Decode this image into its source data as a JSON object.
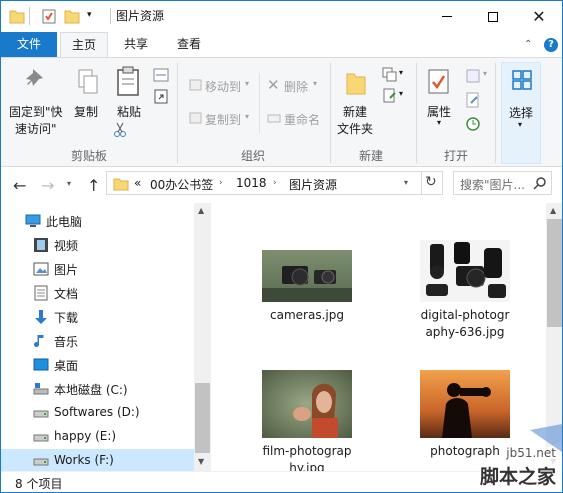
{
  "window": {
    "title": "图片资源"
  },
  "ribbon_tabs": [
    "文件",
    "主页",
    "共享",
    "查看"
  ],
  "clipboard": {
    "pin_label_1": "固定到\"快",
    "pin_label_2": "速访问\"",
    "copy_label": "复制",
    "paste_label": "粘贴",
    "group_label": "剪贴板"
  },
  "organize": {
    "move_label": "移动到",
    "copyto_label": "复制到",
    "delete_label": "删除",
    "rename_label": "重命名",
    "group_label": "组织"
  },
  "new": {
    "folder_label_1": "新建",
    "folder_label_2": "文件夹",
    "group_label": "新建"
  },
  "open": {
    "props_label": "属性",
    "group_label": "打开"
  },
  "select": {
    "label": "选择"
  },
  "address": {
    "overflow": "«",
    "crumbs": [
      "00办公书签",
      "1018",
      "图片资源"
    ],
    "search_placeholder": "搜索\"图片..."
  },
  "nav": {
    "items": [
      {
        "label": "此电脑",
        "icon": "computer-icon"
      },
      {
        "label": "视频",
        "icon": "video-icon"
      },
      {
        "label": "图片",
        "icon": "pictures-icon"
      },
      {
        "label": "文档",
        "icon": "documents-icon"
      },
      {
        "label": "下载",
        "icon": "download-icon"
      },
      {
        "label": "音乐",
        "icon": "music-icon"
      },
      {
        "label": "桌面",
        "icon": "desktop-icon"
      },
      {
        "label": "本地磁盘 (C:)",
        "icon": "drive-c-icon"
      },
      {
        "label": "Softwares (D:)",
        "icon": "drive-icon"
      },
      {
        "label": "happy (E:)",
        "icon": "drive-icon"
      },
      {
        "label": "Works (F:)",
        "icon": "drive-icon"
      }
    ]
  },
  "files": [
    {
      "name_1": "cameras.jpg",
      "name_2": ""
    },
    {
      "name_1": "digital-photogr",
      "name_2": "aphy-636.jpg"
    },
    {
      "name_1": "film-photograp",
      "name_2": "hy.jpg"
    },
    {
      "name_1": "photograph",
      "name_2": ""
    }
  ],
  "status": {
    "count": "8 个项目"
  },
  "watermark": {
    "site": "jb51.net",
    "name": "脚本之家"
  }
}
